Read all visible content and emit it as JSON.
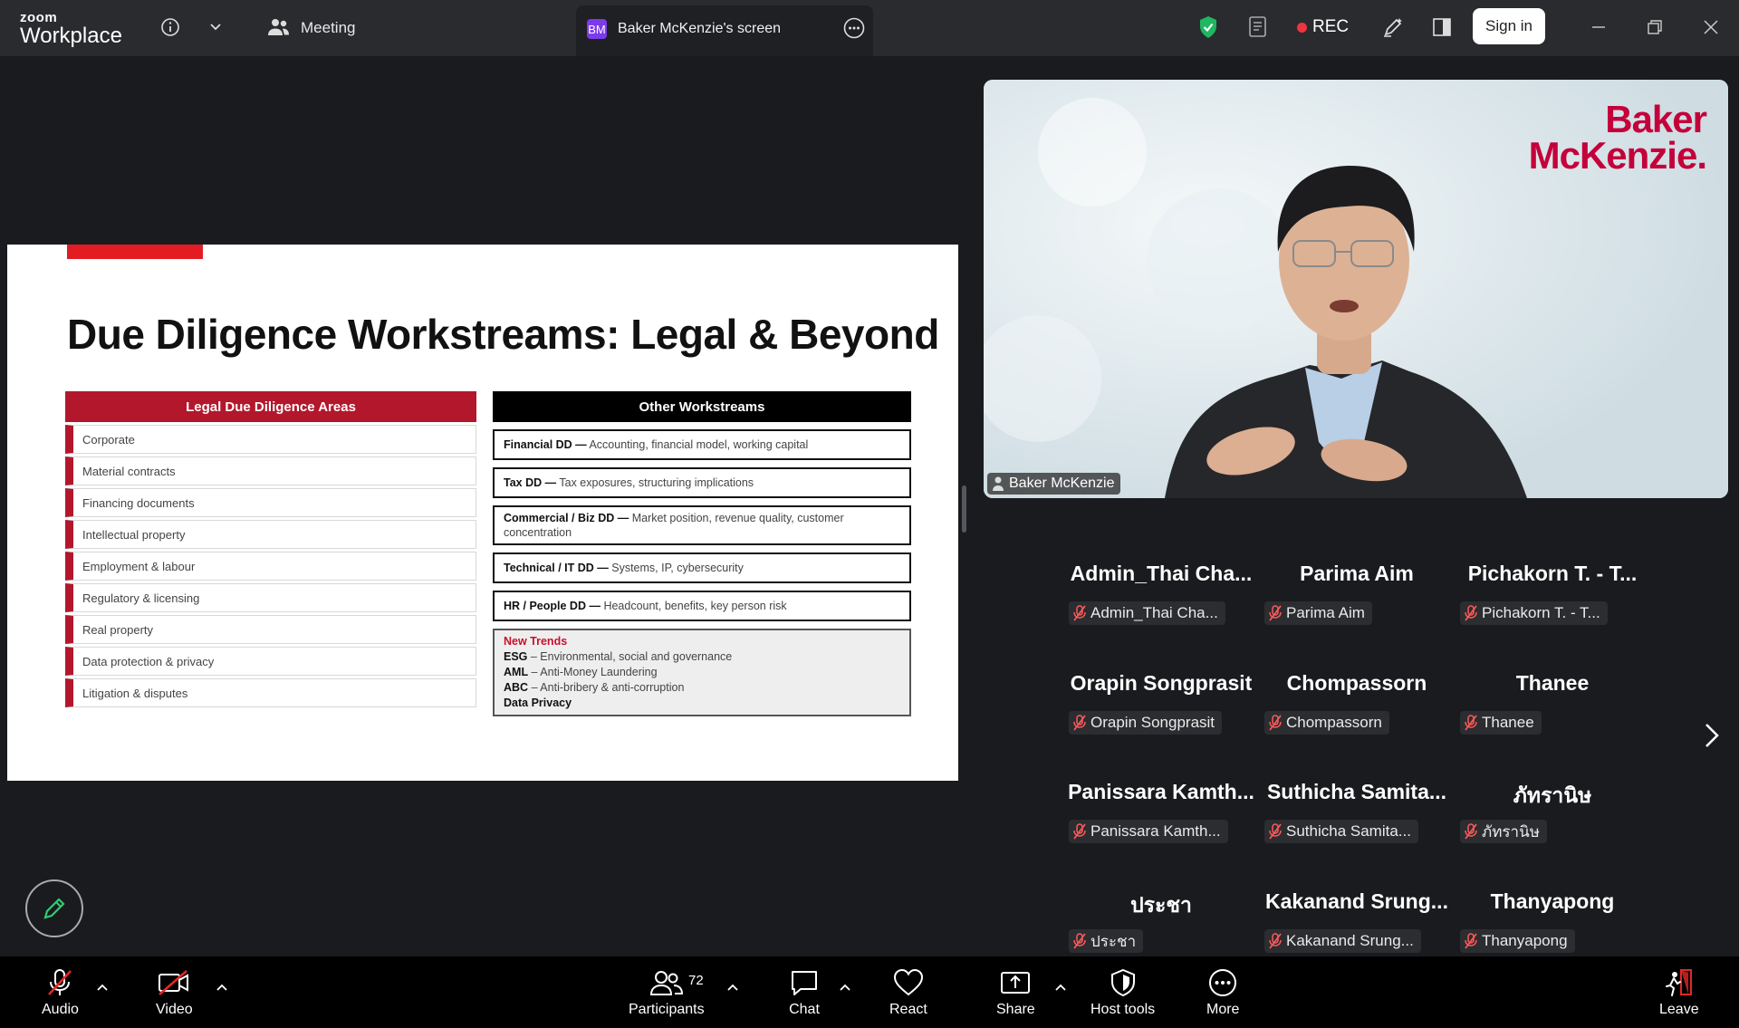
{
  "titlebar": {
    "logo_line1": "zoom",
    "logo_line2": "Workplace",
    "meeting_label": "Meeting",
    "screen_tab_badge": "BM",
    "screen_tab_label": "Baker McKenzie's screen",
    "rec_label": "REC",
    "sign_in": "Sign in",
    "icons": [
      "info-icon",
      "chevron-down-icon",
      "meeting-people-icon",
      "more-icon",
      "shield-check-icon",
      "notes-icon",
      "annotate-icon",
      "layout-icon",
      "minimize-icon",
      "restore-icon",
      "close-icon"
    ],
    "colors": {
      "shield": "#1fb760",
      "rec_dot": "#ef3340"
    }
  },
  "slide": {
    "title": "Due Diligence Workstreams: Legal & Beyond",
    "legal_header": "Legal Due Diligence Areas",
    "legal_items": [
      "Corporate",
      "Material contracts",
      "Financing documents",
      "Intellectual property",
      "Employment & labour",
      "Regulatory & licensing",
      "Real property",
      "Data protection & privacy",
      "Litigation & disputes"
    ],
    "other_header": "Other Workstreams",
    "workstreams": [
      {
        "name": "Financial DD —",
        "desc": " Accounting, financial model, working capital"
      },
      {
        "name": "Tax DD —",
        "desc": " Tax exposures, structuring implications"
      },
      {
        "name": "Commercial / Biz DD —",
        "desc": " Market position, revenue quality, customer concentration"
      },
      {
        "name": "Technical / IT DD —",
        "desc": " Systems, IP, cybersecurity"
      },
      {
        "name": "HR / People DD —",
        "desc": " Headcount, benefits, key person risk"
      }
    ],
    "trends": {
      "heading": "New Trends",
      "items": [
        {
          "key": "ESG",
          "desc": " – Environmental, social and governance"
        },
        {
          "key": "AML",
          "desc": " – Anti-Money Laundering"
        },
        {
          "key": "ABC",
          "desc": " – Anti-bribery & anti-corruption"
        },
        {
          "key": "Data Privacy",
          "desc": ""
        }
      ]
    },
    "colors": {
      "accent_red": "#b2172c",
      "bar_red": "#e31b23"
    }
  },
  "video": {
    "logo_line1": "Baker",
    "logo_line2": "McKenzie.",
    "name": "Baker McKenzie"
  },
  "participants": [
    {
      "name": "Admin_Thai  Cha...",
      "pill": "Admin_Thai Cha..."
    },
    {
      "name": "Parima Aim",
      "pill": "Parima Aim"
    },
    {
      "name": "Pichakorn T. - T...",
      "pill": "Pichakorn T. - T..."
    },
    {
      "name": "Orapin Songprasit",
      "pill": "Orapin Songprasit"
    },
    {
      "name": "Chompassorn",
      "pill": "Chompassorn"
    },
    {
      "name": "Thanee",
      "pill": "Thanee"
    },
    {
      "name": "Panissara  Kamth...",
      "pill": "Panissara Kamth..."
    },
    {
      "name": "Suthicha  Samita...",
      "pill": "Suthicha Samita..."
    },
    {
      "name": "ภัทรานิษ",
      "pill": "ภัทรานิษ"
    },
    {
      "name": "ประชา",
      "pill": "ประชา"
    },
    {
      "name": "Kakanand  Srung...",
      "pill": "Kakanand Srung..."
    },
    {
      "name": "Thanyapong",
      "pill": "Thanyapong"
    }
  ],
  "toolbar": {
    "audio": "Audio",
    "video": "Video",
    "participants": "Participants",
    "participant_count": "72",
    "chat": "Chat",
    "react": "React",
    "share": "Share",
    "host_tools": "Host tools",
    "more": "More",
    "leave": "Leave",
    "colors": {
      "muted": "#e02828",
      "share_icon": "#ffffff"
    }
  }
}
